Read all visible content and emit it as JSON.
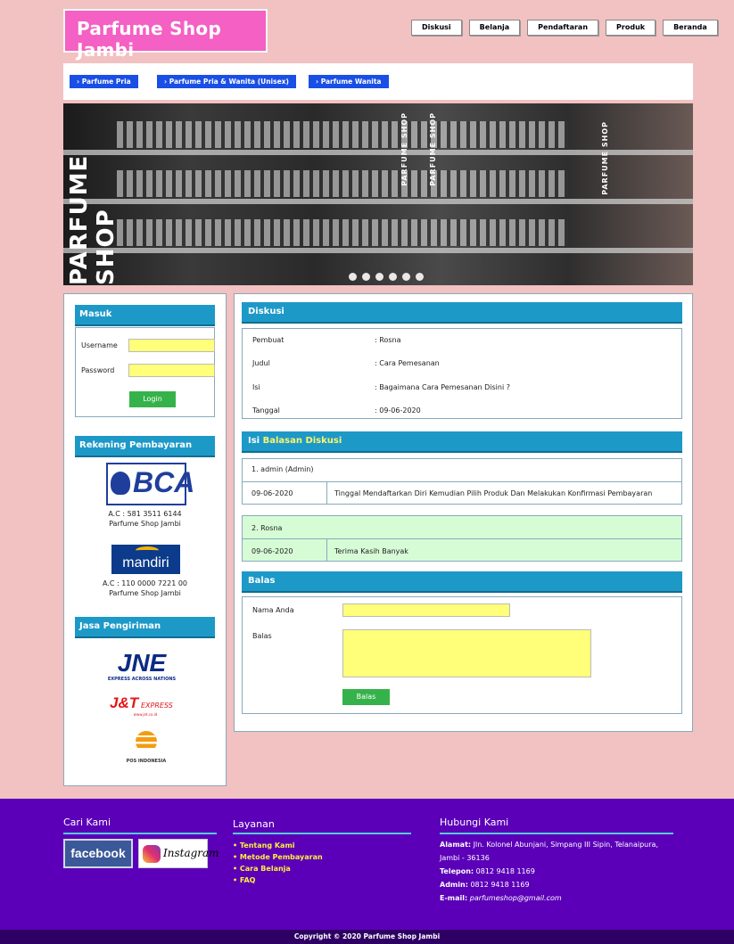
{
  "header": {
    "logo": "Parfume Shop Jambi",
    "nav": [
      "Diskusi",
      "Belanja",
      "Pendaftaran",
      "Produk",
      "Beranda"
    ]
  },
  "categories": [
    "› Parfume Pria",
    "› Parfume Pria & Wanita (Unisex)",
    "› Parfume Wanita"
  ],
  "banner": {
    "sign_text": "PARFUME SHOP"
  },
  "sidebar": {
    "login": {
      "title": "Masuk",
      "username_label": "Username",
      "password_label": "Password",
      "button": "Login"
    },
    "rekening": {
      "title": "Rekening Pembayaran",
      "banks": [
        {
          "logo": "BCA",
          "account": "A.C : 581 3511 6144",
          "holder": "Parfume Shop Jambi"
        },
        {
          "logo": "mandiri",
          "account": "A.C : 110 0000 7221 00",
          "holder": "Parfume Shop Jambi"
        }
      ]
    },
    "shipping": {
      "title": "Jasa Pengiriman",
      "jne": "JNE",
      "jne_tag": "EXPRESS ACROSS NATIONS",
      "jnt": "J&T",
      "jnt_tag": "EXPRESS",
      "jnt_url": "www.jet.co.id",
      "pos": "POS INDONESIA"
    }
  },
  "discussion": {
    "title": "Diskusi",
    "fields": [
      {
        "label": "Pembuat",
        "value": ": Rosna"
      },
      {
        "label": "Judul",
        "value": ": Cara Pemesanan"
      },
      {
        "label": "Isi",
        "value": ": Bagaimana Cara Pemesanan Disini ?"
      },
      {
        "label": "Tanggal",
        "value": ": 09-06-2020"
      }
    ]
  },
  "replies": {
    "title_prefix": "Isi ",
    "title_highlight": "Balasan Diskusi",
    "items": [
      {
        "author": "1. admin (Admin)",
        "date": "09-06-2020",
        "text": "Tinggal Mendaftarkan Diri Kemudian Pilih Produk Dan Melakukan Konfirmasi Pembayaran"
      },
      {
        "author": "2. Rosna",
        "date": "09-06-2020",
        "text": "Terima Kasih Banyak"
      }
    ]
  },
  "reply_form": {
    "title": "Balas",
    "name_label": "Nama Anda",
    "body_label": "Balas",
    "button": "Balas"
  },
  "footer": {
    "find_us": "Cari Kami",
    "facebook": "facebook",
    "instagram": "Instagram",
    "services_title": "Layanan",
    "services": [
      "• Tentang Kami",
      "• Metode Pembayaran",
      "• Cara Belanja",
      "• FAQ"
    ],
    "contact_title": "Hubungi Kami",
    "address_label": "Alamat:",
    "address_line1": "Jln. Kolonel Abunjani, Simpang III Sipin, Telanaipura,",
    "address_line2": "Jambi - 36136",
    "phone_label": "Telepon:",
    "phone": "0812 9418 1169",
    "admin_label": "Admin:",
    "admin": "0812 9418 1169",
    "email_label": "E-mail:",
    "email": "parfumeshop@gmail.com"
  },
  "copyright": "Copyright © 2020 Parfume Shop Jambi",
  "colors": {
    "accent": "#1d99c8",
    "footer": "#5b00b8",
    "page_bg": "#f2c1c1"
  }
}
